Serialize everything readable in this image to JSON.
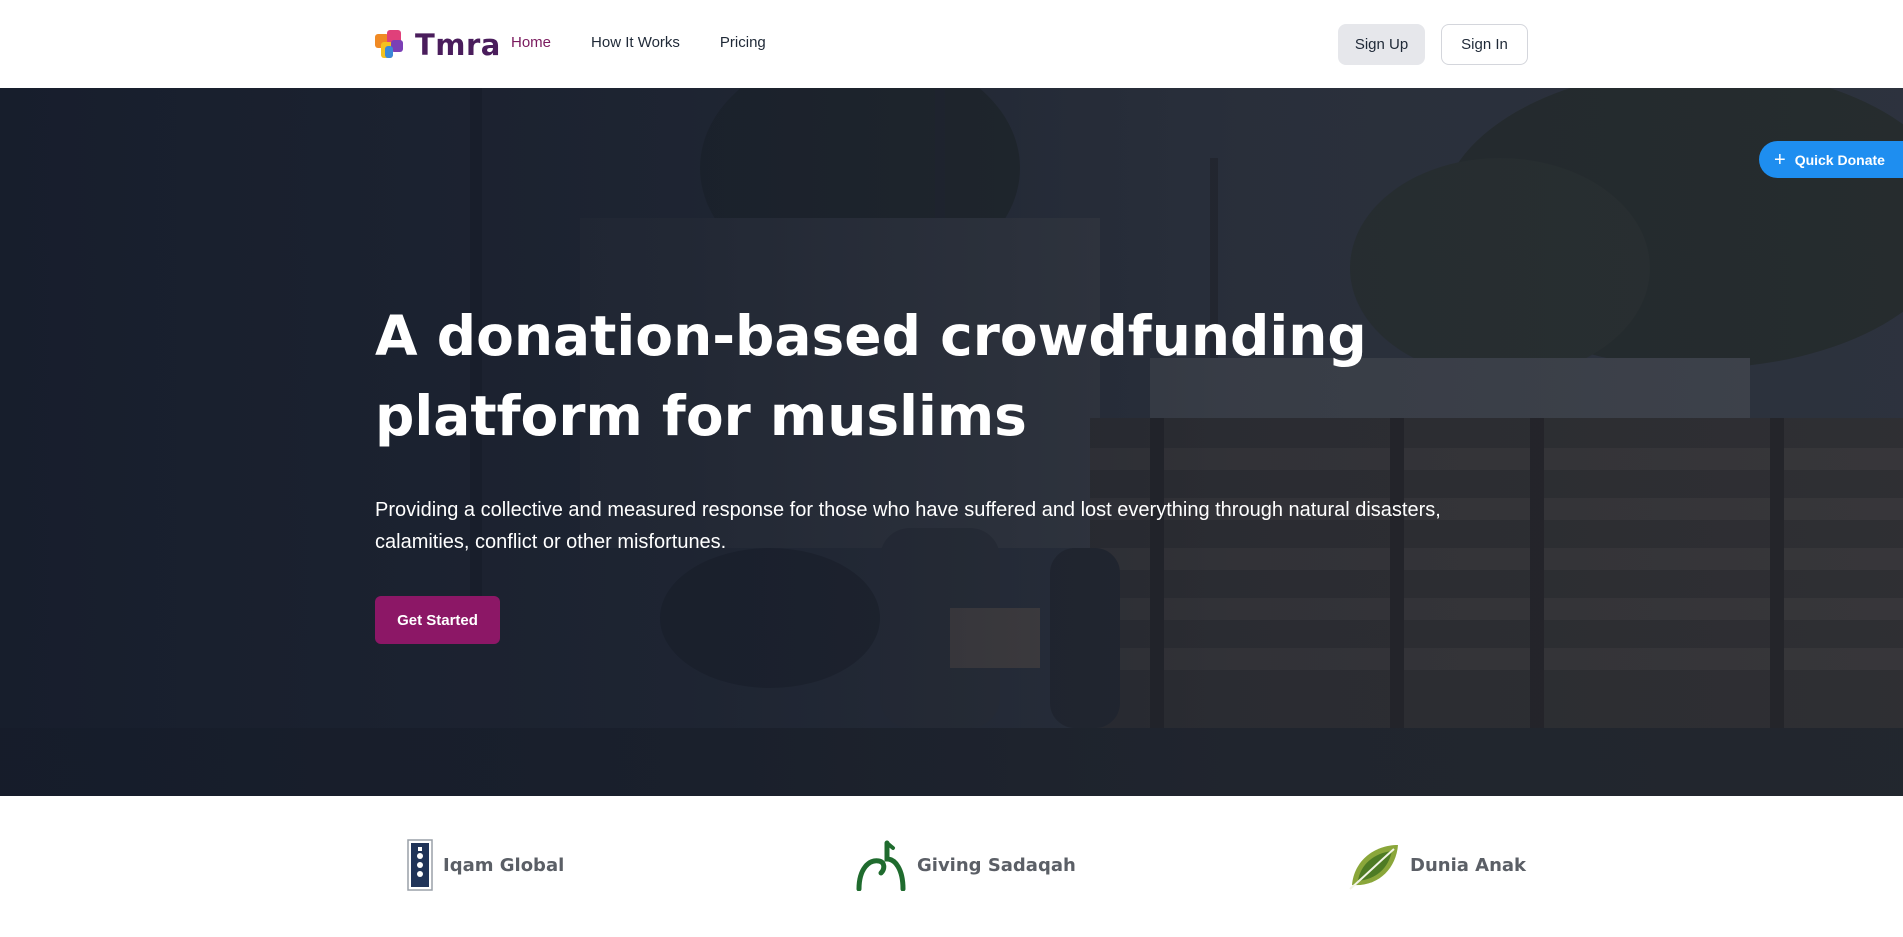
{
  "brand": {
    "name": "Tmra",
    "colors": {
      "primary": "#8c1766",
      "accent": "#1e8ef0",
      "logo_text": "#4a1d5c"
    }
  },
  "nav": {
    "links": [
      {
        "label": "Home",
        "active": true
      },
      {
        "label": "How It Works",
        "active": false
      },
      {
        "label": "Pricing",
        "active": false
      }
    ],
    "signup_label": "Sign Up",
    "signin_label": "Sign In"
  },
  "quick_donate": {
    "label": "Quick Donate",
    "icon": "plus-icon"
  },
  "hero": {
    "title": "A donation-based crowdfunding platform for muslims",
    "subtitle": "Providing a collective and measured response for those who have suffered and lost everything through natural disasters, calamities, conflict or other misfortunes.",
    "cta_label": "Get Started"
  },
  "partners": [
    {
      "name": "Iqam Global",
      "icon": "iqam-logo-icon"
    },
    {
      "name": "Giving Sadaqah",
      "icon": "giving-sadaqah-logo-icon"
    },
    {
      "name": "Dunia Anak",
      "icon": "dunia-anak-logo-icon"
    }
  ]
}
